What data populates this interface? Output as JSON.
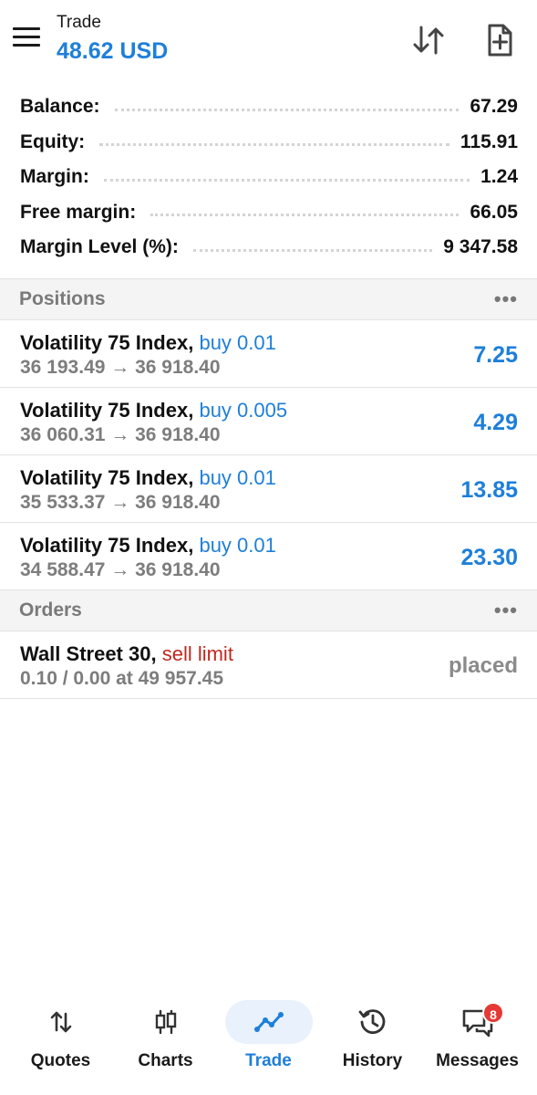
{
  "header": {
    "title": "Trade",
    "profit": "48.62 USD",
    "menu_icon": "hamburger-menu-icon",
    "sort_icon": "sort-arrows-icon",
    "new_order_icon": "new-order-document-plus-icon"
  },
  "summary": [
    {
      "label": "Balance:",
      "value": "67.29"
    },
    {
      "label": "Equity:",
      "value": "115.91"
    },
    {
      "label": "Margin:",
      "value": "1.24"
    },
    {
      "label": "Free margin:",
      "value": "66.05"
    },
    {
      "label": "Margin Level (%):",
      "value": "9 347.58"
    }
  ],
  "positions": {
    "title": "Positions",
    "more": "•••",
    "items": [
      {
        "symbol": "Volatility 75 Index,",
        "type": "buy 0.01",
        "prices": "36 193.49 → 36 918.40",
        "profit": "7.25"
      },
      {
        "symbol": "Volatility 75 Index,",
        "type": "buy 0.005",
        "prices": "36 060.31 → 36 918.40",
        "profit": "4.29"
      },
      {
        "symbol": "Volatility 75 Index,",
        "type": "buy 0.01",
        "prices": "35 533.37 → 36 918.40",
        "profit": "13.85"
      },
      {
        "symbol": "Volatility 75 Index,",
        "type": "buy 0.01",
        "prices": "34 588.47 → 36 918.40",
        "profit": "23.30"
      }
    ]
  },
  "orders": {
    "title": "Orders",
    "more": "•••",
    "items": [
      {
        "symbol": "Wall Street 30,",
        "type": "sell limit",
        "details": "0.10 / 0.00 at 49 957.45",
        "status": "placed"
      }
    ]
  },
  "nav": {
    "items": [
      {
        "label": "Quotes",
        "icon": "quotes-arrows-icon"
      },
      {
        "label": "Charts",
        "icon": "candlestick-chart-icon"
      },
      {
        "label": "Trade",
        "icon": "trade-line-icon",
        "active": true
      },
      {
        "label": "History",
        "icon": "history-clock-icon"
      },
      {
        "label": "Messages",
        "icon": "messages-chat-icon",
        "badge": "8"
      }
    ]
  },
  "colors": {
    "accent": "#1e7fd9",
    "sell": "#c0281f",
    "muted": "#7d7d7d",
    "badge": "#e53935"
  }
}
